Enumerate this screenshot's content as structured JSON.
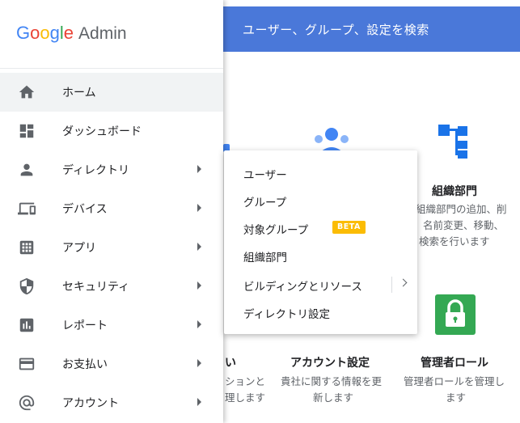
{
  "logo": {
    "brand_letters": [
      "G",
      "o",
      "o",
      "g",
      "l",
      "e"
    ],
    "product": "Admin"
  },
  "search": {
    "placeholder": "ユーザー、グループ、設定を検索"
  },
  "nav": {
    "items": [
      {
        "label": "ホーム",
        "icon": "home-icon",
        "active": true,
        "has_submenu": false
      },
      {
        "label": "ダッシュボード",
        "icon": "dashboard-icon",
        "active": false,
        "has_submenu": false
      },
      {
        "label": "ディレクトリ",
        "icon": "person-icon",
        "active": false,
        "has_submenu": true
      },
      {
        "label": "デバイス",
        "icon": "devices-icon",
        "active": false,
        "has_submenu": true
      },
      {
        "label": "アプリ",
        "icon": "apps-grid-icon",
        "active": false,
        "has_submenu": true
      },
      {
        "label": "セキュリティ",
        "icon": "shield-icon",
        "active": false,
        "has_submenu": true
      },
      {
        "label": "レポート",
        "icon": "report-chart-icon",
        "active": false,
        "has_submenu": true
      },
      {
        "label": "お支払い",
        "icon": "credit-card-icon",
        "active": false,
        "has_submenu": true
      },
      {
        "label": "アカウント",
        "icon": "at-sign-icon",
        "active": false,
        "has_submenu": true
      }
    ]
  },
  "flyout": {
    "items": [
      {
        "label": "ユーザー"
      },
      {
        "label": "グループ"
      },
      {
        "label": "対象グループ",
        "badge": "BETA"
      },
      {
        "label": "組織部門"
      },
      {
        "label": "ビルディングとリソース",
        "has_submenu": true
      },
      {
        "label": "ディレクトリ設定"
      }
    ]
  },
  "cards": {
    "org": {
      "title": "組織部門",
      "desc": [
        "組織部門の追加、削",
        "名前変更、移動、",
        "検索を行います"
      ]
    },
    "partial": {
      "title": "い",
      "desc": [
        "ションと",
        "理します"
      ]
    },
    "account": {
      "title": "アカウント設定",
      "desc": [
        "貴社に関する情報を更",
        "新します"
      ]
    },
    "admin_roles": {
      "title": "管理者ロール",
      "desc": [
        "管理者ロールを管理し",
        "ます"
      ]
    }
  },
  "colors": {
    "search_bar": "#4a78d9",
    "org_icon": "#1a73e8",
    "users_icon": "#4285f4",
    "admin_roles_icon": "#34a853",
    "beta_badge": "#fbbc04"
  }
}
